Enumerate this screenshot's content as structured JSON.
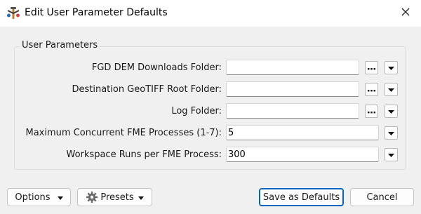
{
  "window": {
    "title": "Edit User Parameter Defaults",
    "icon": "fme-workbench-icon",
    "close_icon": "close-icon"
  },
  "group": {
    "title": "User Parameters"
  },
  "parameters": [
    {
      "label": "FGD DEM Downloads Folder:",
      "value": "",
      "has_browse": true,
      "has_dropdown": true
    },
    {
      "label": "Destination GeoTIFF Root Folder:",
      "value": "",
      "has_browse": true,
      "has_dropdown": true
    },
    {
      "label": "Log Folder:",
      "value": "",
      "has_browse": true,
      "has_dropdown": true
    },
    {
      "label": "Maximum Concurrent FME Processes (1-7):",
      "value": "5",
      "has_browse": false,
      "has_dropdown": true
    },
    {
      "label": "Workspace Runs per FME Process:",
      "value": "300",
      "has_browse": false,
      "has_dropdown": true
    }
  ],
  "footer": {
    "options_label": "Options",
    "presets_label": "Presets",
    "save_defaults_label": "Save as Defaults",
    "cancel_label": "Cancel"
  }
}
